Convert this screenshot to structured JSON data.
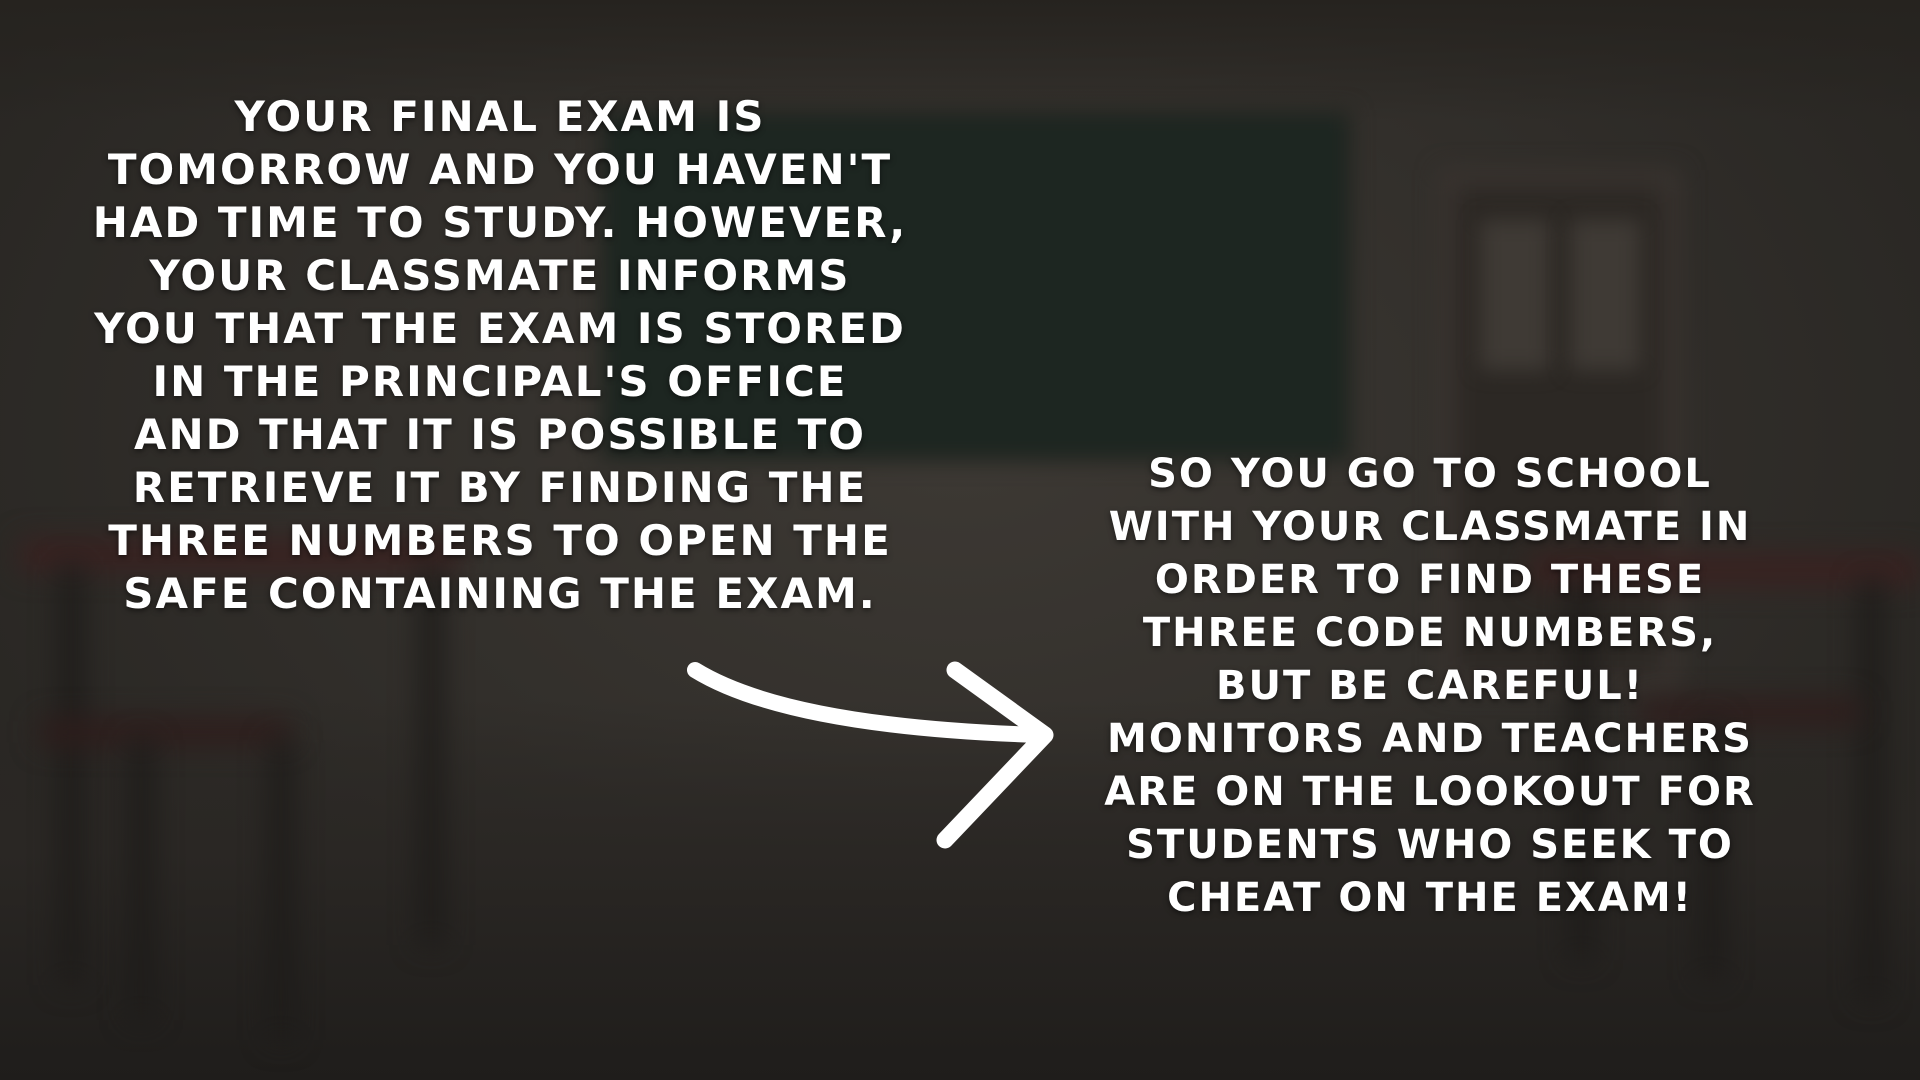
{
  "intro": {
    "text_left": "Your final exam is tomorrow and you haven't had time to study. However, your classmate informs you that the exam is stored in the principal's office and that it is possible to retrieve it by finding the three numbers to open the safe containing the exam.",
    "text_right": "So you go to school with your classmate in order to find these three code numbers, but be careful! Monitors and teachers are on the lookout for students who seek to cheat on the exam!",
    "arrow_icon": "arrow-right-icon"
  },
  "colors": {
    "text": "#ffffff",
    "background": "#2e2b28",
    "chalkboard": "#1d2621",
    "desk": "#3a2120"
  }
}
